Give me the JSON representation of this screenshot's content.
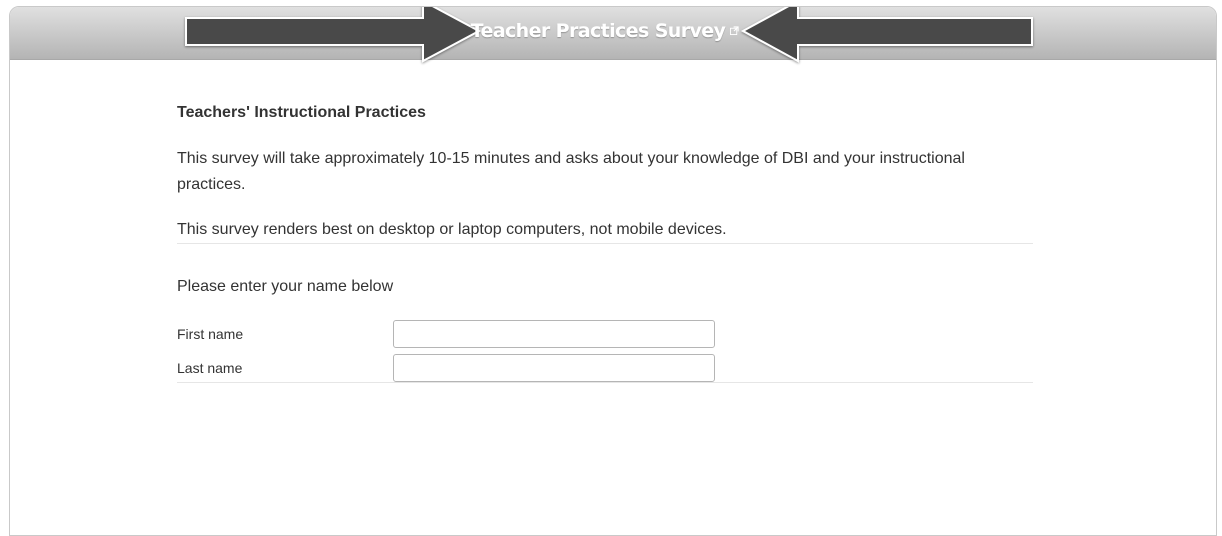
{
  "survey": {
    "title": "Teacher Practices Survey",
    "section_title": "Teachers' Instructional Practices",
    "intro_text": "This survey will take approximately 10-15 minutes and asks about your knowledge of DBI and your instructional practices.",
    "device_note": "This survey renders best on desktop or laptop computers, not mobile devices.",
    "name_prompt": "Please enter your name below",
    "fields": [
      {
        "label": "First name",
        "value": ""
      },
      {
        "label": "Last name",
        "value": ""
      }
    ]
  },
  "icons": [
    "external-link-icon",
    "right-arrow-annotation",
    "left-arrow-annotation"
  ],
  "colors": {
    "titlebar_top": "#e0e0e0",
    "titlebar_bottom": "#b4b4b4",
    "title_text": "#ffffff",
    "arrow_fill": "#4a4a4a",
    "body_text": "#333333"
  }
}
